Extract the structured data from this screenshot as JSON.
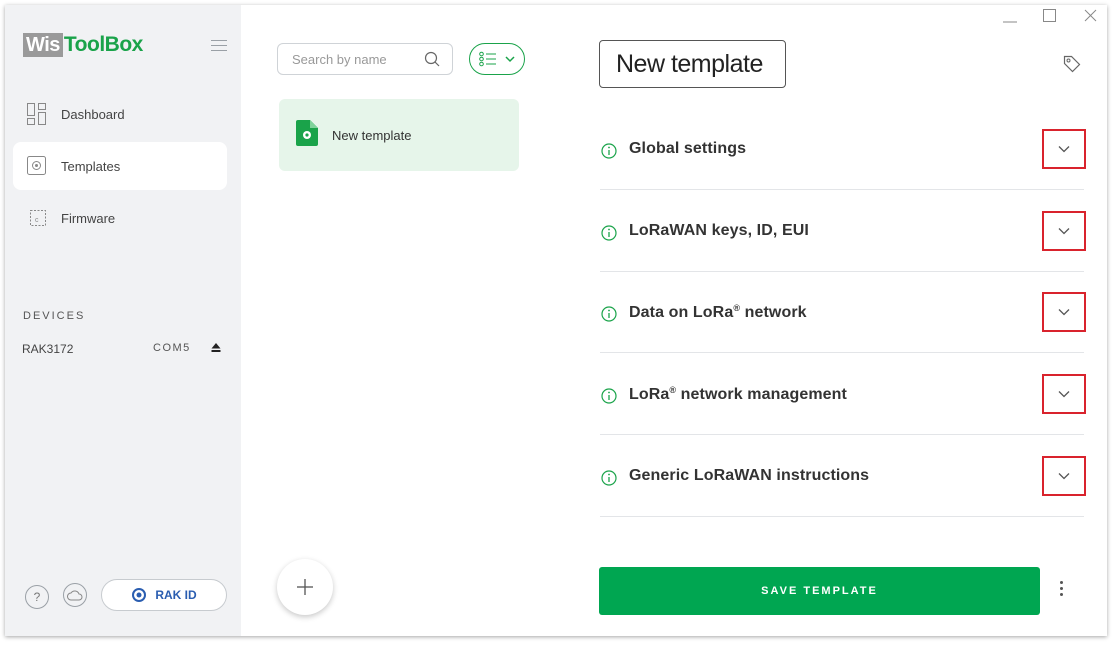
{
  "app": {
    "logo_part1": "Wis",
    "logo_part2": "ToolBox",
    "brand_green": "#1aa34a",
    "accent_red": "#d9232d"
  },
  "sidebar": {
    "items": [
      {
        "label": "Dashboard",
        "icon": "dashboard-icon"
      },
      {
        "label": "Templates",
        "icon": "templates-icon",
        "active": true
      },
      {
        "label": "Firmware",
        "icon": "firmware-chip-icon"
      }
    ],
    "devices_heading": "DEVICES",
    "device": {
      "name": "RAK3172",
      "port": "COM5"
    },
    "rak_id_label": "RAK ID"
  },
  "list": {
    "search_placeholder": "Search by name",
    "templates": [
      {
        "label": "New template"
      }
    ]
  },
  "editor": {
    "template_name": "New template",
    "sections": [
      {
        "title": "Global settings"
      },
      {
        "title": "LoRaWAN keys, ID, EUI"
      },
      {
        "title_pre": "Data on LoRa",
        "sup": "®",
        "title_post": " network"
      },
      {
        "title_pre": "LoRa",
        "sup": "®",
        "title_post": " network management"
      },
      {
        "title": "Generic LoRaWAN instructions"
      }
    ],
    "save_label": "SAVE TEMPLATE"
  }
}
